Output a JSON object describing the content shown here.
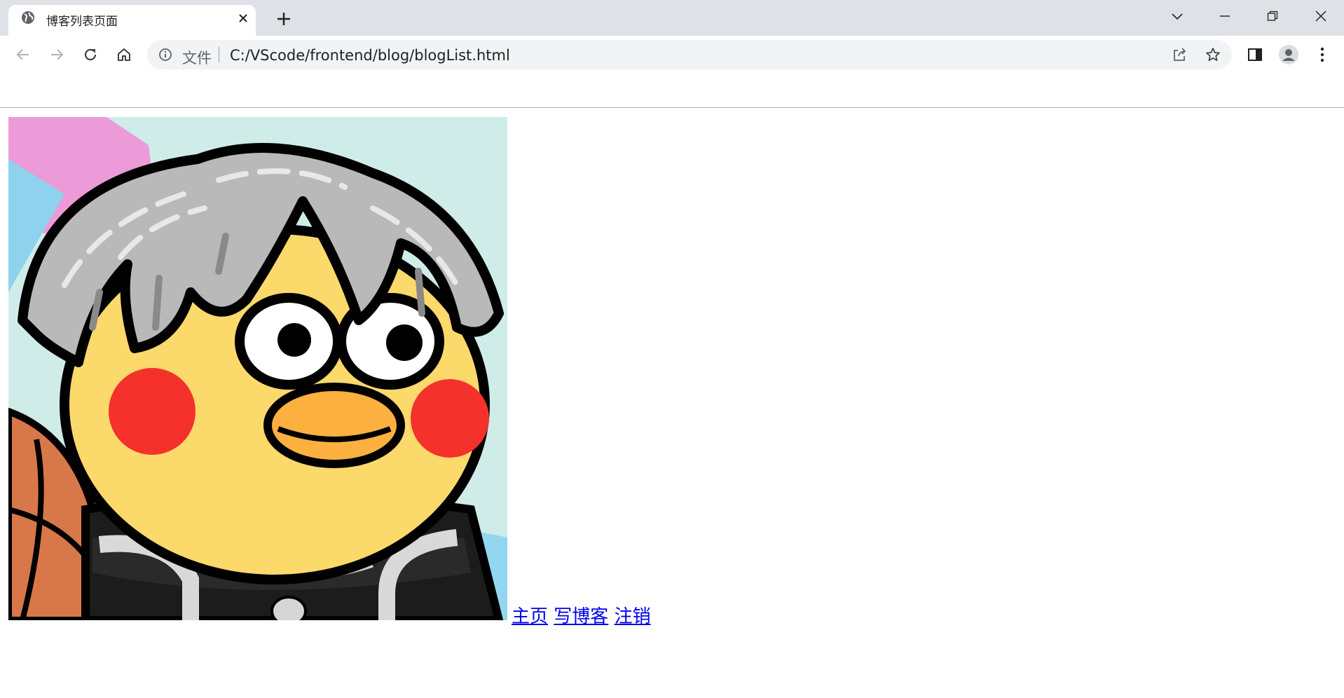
{
  "browser": {
    "tab": {
      "title": "博客列表页面",
      "favicon_icon": "globe-icon",
      "close_icon": "close-icon"
    },
    "new_tab_icon": "plus-icon",
    "window_controls": [
      "chevron-down-icon",
      "minimize-icon",
      "restore-icon",
      "close-icon"
    ],
    "toolbar": {
      "back_icon": "arrow-left-icon",
      "forward_icon": "arrow-right-icon",
      "reload_icon": "reload-icon",
      "home_icon": "home-icon"
    },
    "omnibox": {
      "info_icon": "info-icon",
      "scheme_label": "文件",
      "url": "C:/VScode/frontend/blog/blogList.html",
      "share_icon": "share-icon",
      "bookmark_icon": "star-icon"
    },
    "right_icons": [
      "side-panel-icon",
      "profile-icon",
      "kebab-menu-icon"
    ]
  },
  "page": {
    "avatar_icon": "cartoon-duck-avatar",
    "nav": {
      "home": "主页",
      "write": "写博客",
      "logout": "注销"
    }
  },
  "colors": {
    "tabstrip_bg": "#dee1e6",
    "omnibox_bg": "#f1f3f4",
    "link": "#0000ee"
  }
}
